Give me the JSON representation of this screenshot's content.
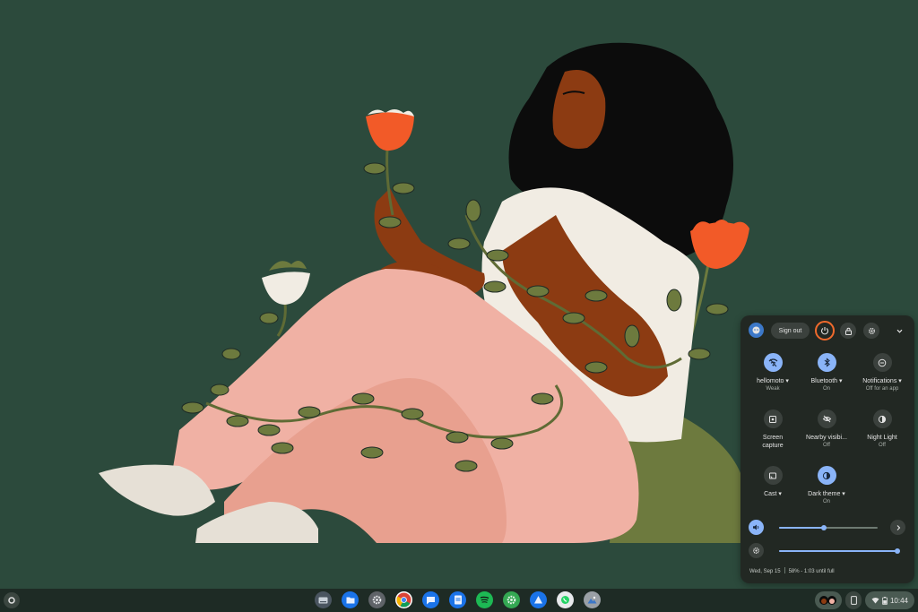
{
  "colors": {
    "wallpaper_bg": "#2c4a3c",
    "panel_bg": "#222823",
    "accent": "#8ab4f8",
    "power_highlight": "#f06a2c",
    "flower": "#f25a28",
    "pants": "#f0b1a4",
    "shirt": "#f1ece3",
    "skin": "#8c3b12",
    "hair": "#0c0c0c",
    "leaf": "#6d7a3e"
  },
  "quick_settings": {
    "header": {
      "sign_out_label": "Sign out",
      "icons": [
        "user-avatar-icon",
        "power-icon",
        "lock-icon",
        "settings-gear-icon",
        "collapse-chevron-icon"
      ]
    },
    "tiles": [
      {
        "label": "hellomoto",
        "sub": "Weak",
        "state": "on",
        "icon": "wifi-weak-icon",
        "has_dropdown": true
      },
      {
        "label": "Bluetooth",
        "sub": "On",
        "state": "on",
        "icon": "bluetooth-icon",
        "has_dropdown": true
      },
      {
        "label": "Notifications",
        "sub": "Off for an app",
        "state": "off",
        "icon": "notifications-icon",
        "has_dropdown": true
      },
      {
        "label": "Screen\ncapture",
        "sub": "",
        "state": "off",
        "icon": "screen-capture-icon",
        "has_dropdown": false
      },
      {
        "label": "Nearby visibi...",
        "sub": "Off",
        "state": "off",
        "icon": "nearby-share-off-icon",
        "has_dropdown": false
      },
      {
        "label": "Night Light",
        "sub": "Off",
        "state": "off",
        "icon": "night-light-icon",
        "has_dropdown": false
      },
      {
        "label": "Cast",
        "sub": "",
        "state": "off",
        "icon": "cast-icon",
        "has_dropdown": true
      },
      {
        "label": "Dark theme",
        "sub": "On",
        "state": "on",
        "icon": "dark-theme-icon",
        "has_dropdown": true
      }
    ],
    "volume_level": 0.45,
    "brightness_level": 1.0,
    "date": "Wed, Sep 15",
    "battery_status": "58% - 1:03 until full"
  },
  "shelf": {
    "apps": [
      "keyboard-app-icon",
      "files-icon",
      "settings-app-icon",
      "chrome-icon",
      "messages-icon",
      "docs-icon",
      "spotify-icon",
      "gear-app-icon",
      "vpn-icon",
      "whatsapp-icon",
      "camera-app-icon"
    ],
    "time": "10:44"
  }
}
